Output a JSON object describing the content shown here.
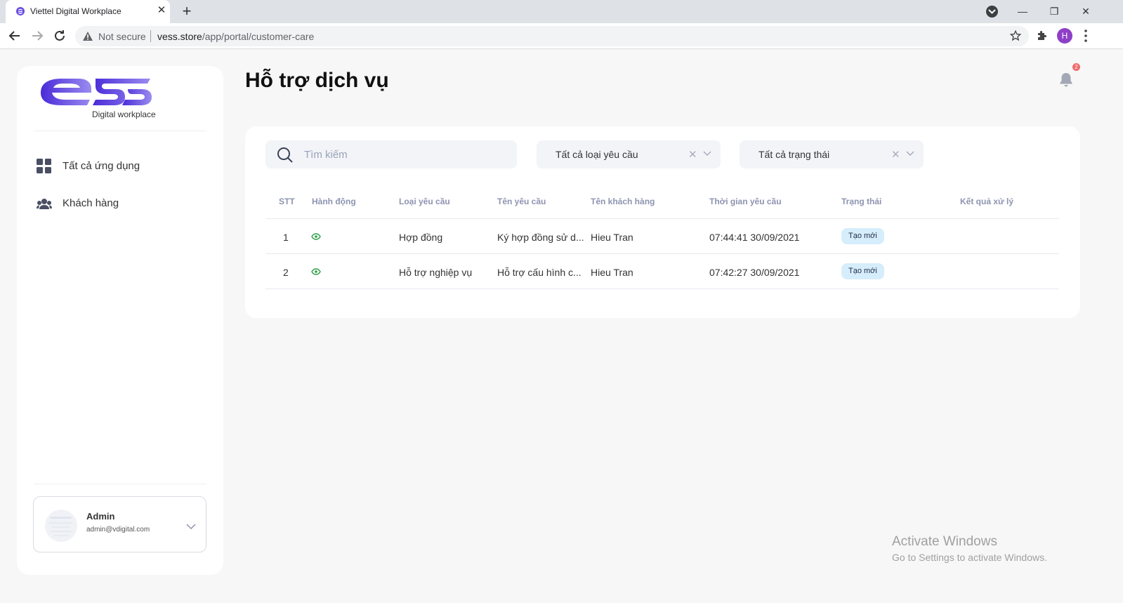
{
  "browser": {
    "tab_title": "Viettel Digital Workplace",
    "tab_close": "✕",
    "new_tab": "+",
    "security_label": "Not secure",
    "url_host": "vess.store",
    "url_path": "/app/portal/customer-care",
    "profile_initial": "H",
    "window_controls": {
      "minimize": "—",
      "restore": "❐",
      "close": "✕"
    }
  },
  "sidebar": {
    "logo_subtitle": "Digital workplace",
    "items": [
      {
        "label": "Tất cả ứng dụng",
        "icon": "grid-icon"
      },
      {
        "label": "Khách hàng",
        "icon": "users-icon"
      }
    ],
    "user": {
      "name": "Admin",
      "email": "admin@vdigital.com"
    }
  },
  "header": {
    "title": "Hỗ trợ dịch vụ",
    "notification_count": "2"
  },
  "filters": {
    "search_placeholder": "Tìm kiếm",
    "request_type": "Tất cả loại yêu cầu",
    "status": "Tất cả trạng thái",
    "clear": "✕"
  },
  "table": {
    "columns": [
      "STT",
      "Hành động",
      "Loại yêu cầu",
      "Tên yêu cầu",
      "Tên khách hàng",
      "Thời gian yêu cầu",
      "Trạng thái",
      "Kết quả xử lý"
    ],
    "rows": [
      {
        "stt": "1",
        "type": "Hợp đồng",
        "name": "Ký hợp đồng sử d...",
        "customer": "Hieu Tran",
        "time": "07:44:41 30/09/2021",
        "status": "Tạo mới",
        "result": ""
      },
      {
        "stt": "2",
        "type": "Hỗ trợ nghiệp vụ",
        "name": "Hỗ trợ cấu hình c...",
        "customer": "Hieu Tran",
        "time": "07:42:27 30/09/2021",
        "status": "Tạo mới",
        "result": ""
      }
    ]
  },
  "watermark": {
    "line1": "Activate Windows",
    "line2": "Go to Settings to activate Windows."
  },
  "colors": {
    "brand_start": "#4a2bd8",
    "brand_end": "#9a8cf0",
    "status_badge": "#d6edfb",
    "eye_icon": "#2e9e45",
    "notification_badge": "#f26b6b"
  }
}
